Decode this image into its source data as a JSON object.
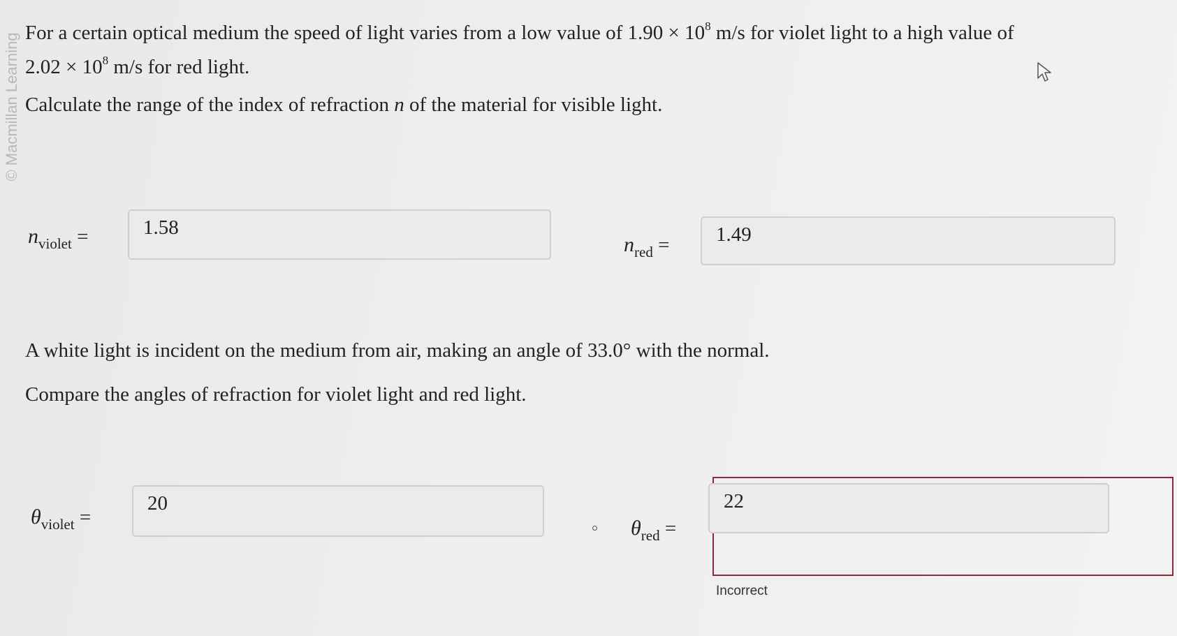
{
  "watermark": "© Macmillan Learning",
  "question": {
    "line1_prefix": "For a certain optical medium the speed of light varies from a low value of 1.90 × 10",
    "line1_exp": "8",
    "line1_suffix": " m/s for violet light to a high value of",
    "line2_prefix": "2.02 × 10",
    "line2_exp": "8",
    "line2_suffix": " m/s for red light.",
    "prompt1_prefix": "Calculate the range of the index of refraction ",
    "prompt1_var": "n",
    "prompt1_suffix": " of the material for visible light.",
    "part2_intro": "A white light is incident on the medium from air, making an angle of 33.0° with the normal.",
    "prompt2": "Compare the angles of refraction for violet light and red light."
  },
  "answers": {
    "n_violet": {
      "symbol": "n",
      "subscript": "violet",
      "equals": "=",
      "value": "1.58"
    },
    "n_red": {
      "symbol": "n",
      "subscript": "red",
      "equals": "=",
      "value": "1.49"
    },
    "theta_violet": {
      "symbol": "θ",
      "subscript": "violet",
      "equals": "=",
      "value": "20"
    },
    "theta_red": {
      "symbol": "θ",
      "subscript": "red",
      "equals": "=",
      "value": "22",
      "status": "Incorrect"
    }
  },
  "colors": {
    "incorrect_border": "#8b2a3a",
    "box_background": "#ebebeb"
  }
}
